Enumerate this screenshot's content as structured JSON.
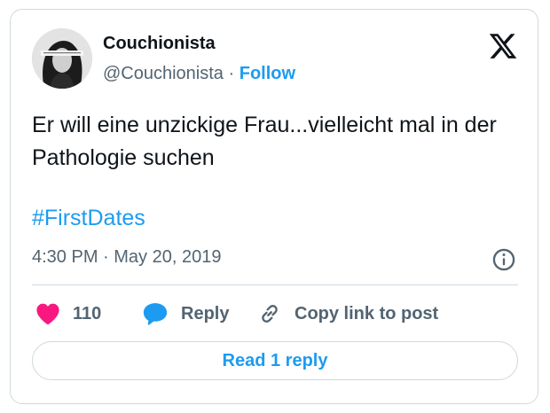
{
  "author": {
    "display_name": "Couchionista",
    "handle": "@Couchionista",
    "separator": "·",
    "follow_label": "Follow"
  },
  "tweet": {
    "text": "Er will eine unzickige Frau...vielleicht mal in der Pathologie suchen",
    "hashtag": "#FirstDates",
    "timestamp": "4:30 PM · May 20, 2019"
  },
  "actions": {
    "like_count": "110",
    "reply_label": "Reply",
    "copy_link_label": "Copy link to post"
  },
  "read_replies_label": "Read 1 reply",
  "icons": {
    "logo": "x-logo-icon",
    "info": "info-icon",
    "like": "heart-icon",
    "reply": "speech-bubble-icon",
    "copy_link": "link-icon"
  },
  "colors": {
    "accent": "#1d9bf0",
    "like": "#f91880",
    "muted_text": "#536471",
    "border": "#cfd9de"
  }
}
